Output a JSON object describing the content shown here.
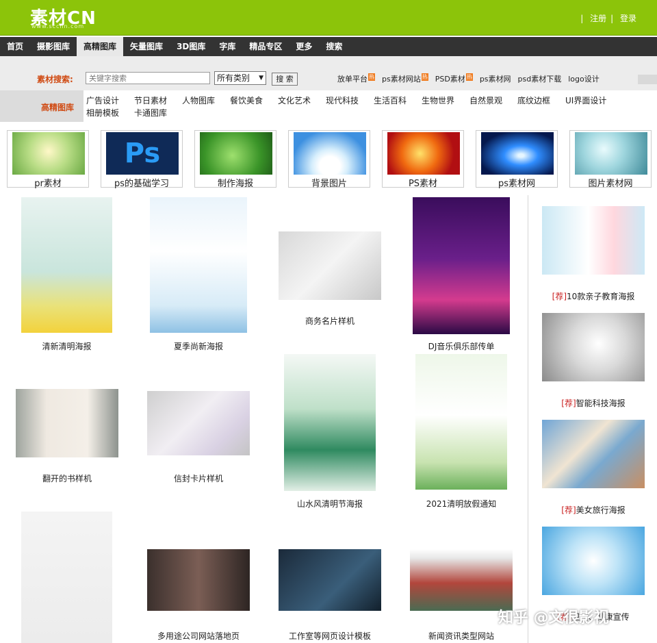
{
  "header": {
    "logo_text": "素材CN",
    "logo_sub": "www.sccnn.com",
    "links": [
      "注册",
      "登录"
    ]
  },
  "nav": {
    "items": [
      "首页",
      "摄影图库",
      "高精图库",
      "矢量图库",
      "3D图库",
      "字库",
      "精品专区",
      "更多",
      "搜索"
    ],
    "active_index": 2
  },
  "search": {
    "label": "素材搜索:",
    "placeholder": "关键字搜索",
    "category_selected": "所有类别",
    "button_label": "搜 索",
    "hot_links": [
      {
        "label": "放单平台",
        "tag": "热"
      },
      {
        "label": "ps素材网站",
        "tag": "热"
      },
      {
        "label": "PSD素材",
        "tag": "热"
      },
      {
        "label": "ps素材网",
        "tag": ""
      },
      {
        "label": "psd素材下载",
        "tag": ""
      },
      {
        "label": "logo设计",
        "tag": ""
      }
    ]
  },
  "categories": {
    "label": "高精图库",
    "items": [
      "广告设计",
      "节日素材",
      "人物图库",
      "餐饮美食",
      "文化艺术",
      "现代科技",
      "生活百科",
      "生物世界",
      "自然景观",
      "底纹边框",
      "UI界面设计",
      "相册模板",
      "卡通图库"
    ]
  },
  "thumbs": [
    {
      "label": "pr素材"
    },
    {
      "label": "ps的基础学习"
    },
    {
      "label": "制作海报"
    },
    {
      "label": "背景图片"
    },
    {
      "label": "PS素材"
    },
    {
      "label": "ps素材网"
    },
    {
      "label": "图片素材网"
    }
  ],
  "grid": [
    {
      "label": "清新清明海报"
    },
    {
      "label": "夏季尚新海报"
    },
    {
      "label": "商务名片样机"
    },
    {
      "label": "DJ音乐俱乐部传单"
    },
    {
      "label": "翻开的书样机"
    },
    {
      "label": "信封卡片样机"
    },
    {
      "label": "山水风清明节海报"
    },
    {
      "label": "2021清明放假通知"
    },
    {
      "label": "多用途公司网站落地页"
    },
    {
      "label": "工作室等网页设计模板"
    },
    {
      "label": "新闻资讯类型网站"
    }
  ],
  "sidebar": {
    "rec_tag": "[荐]",
    "items": [
      {
        "label": "10款亲子教育海报"
      },
      {
        "label": "智能科技海报"
      },
      {
        "label": "美女旅行海报"
      },
      {
        "label": "卫生、健康宣传"
      }
    ]
  },
  "watermark": "知乎 @文很影视",
  "colors": {
    "header_green": "#8cc40a",
    "nav_dark": "#333333",
    "label_orange": "#d04a12",
    "rec_red": "#c81d1d",
    "hot_tag": "#f07b1e"
  }
}
